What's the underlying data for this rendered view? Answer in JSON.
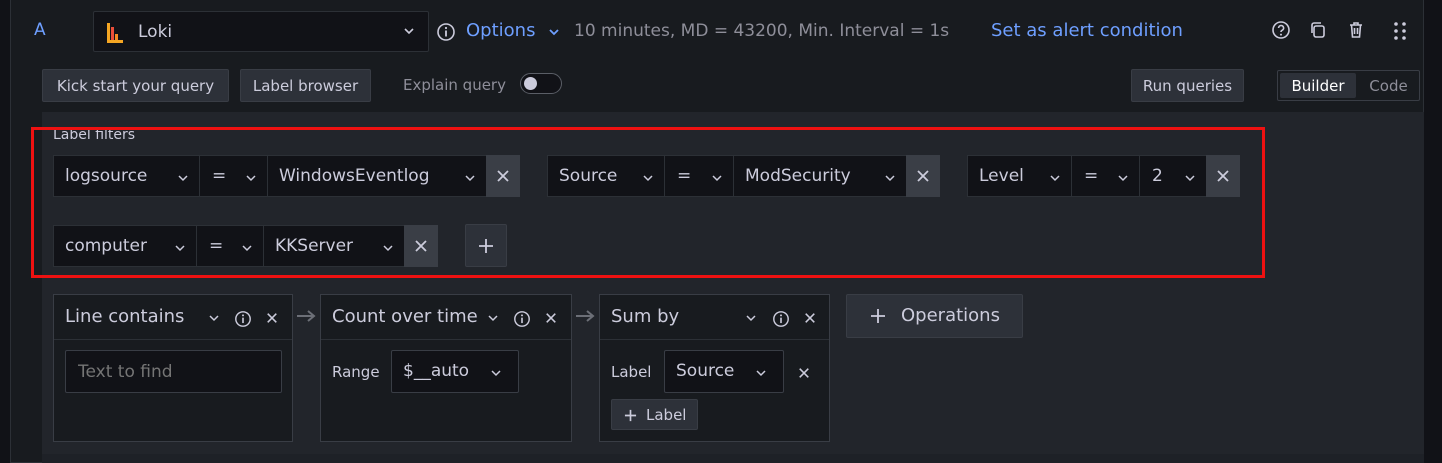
{
  "header": {
    "query_letter": "A",
    "datasource": "Loki",
    "options_label": "Options",
    "options_summary": "10 minutes, MD = 43200, Min. Interval = 1s",
    "alert_link": "Set as alert condition"
  },
  "toolbar": {
    "kickstart": "Kick start your query",
    "label_browser": "Label browser",
    "explain_query": "Explain query",
    "run_queries": "Run queries",
    "mode_builder": "Builder",
    "mode_code": "Code"
  },
  "label_filters": {
    "title": "Label filters",
    "filters": [
      {
        "label": "logsource",
        "op": "=",
        "value": "WindowsEventlog"
      },
      {
        "label": "Source",
        "op": "=",
        "value": "ModSecurity"
      },
      {
        "label": "Level",
        "op": "=",
        "value": "2"
      },
      {
        "label": "computer",
        "op": "=",
        "value": "KKServer"
      }
    ]
  },
  "operations": {
    "line_contains": {
      "name": "Line contains",
      "placeholder": "Text to find"
    },
    "count_over_time": {
      "name": "Count over time",
      "param_label": "Range",
      "param_value": "$__auto"
    },
    "sum_by": {
      "name": "Sum by",
      "param_label": "Label",
      "param_value": "Source",
      "add_label": "Label"
    },
    "add_operations": "Operations"
  },
  "colors": {
    "accent": "#6e9fff",
    "highlight_border": "#ee1111",
    "panel_bg": "#181b1f"
  }
}
